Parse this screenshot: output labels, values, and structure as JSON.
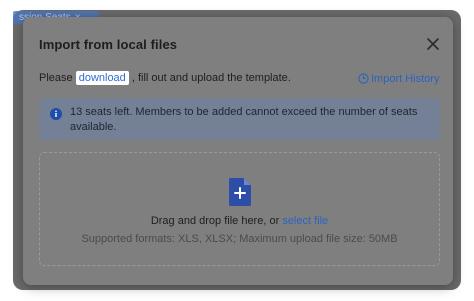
{
  "background": {
    "chip_label": "ssion Seats",
    "chip_close": "×"
  },
  "dialog": {
    "title": "Import from local files",
    "close_icon": "close-icon",
    "instruction_prefix": "Please ",
    "download_link": "download",
    "instruction_suffix": " , fill out and upload the template.",
    "import_history_label": "Import History",
    "alert_text": "13 seats left. Members to be added cannot exceed the number of seats available.",
    "drop_text": "Drag and drop file here, or",
    "select_file_link": "select file",
    "hint_text": "Supported formats: XLS, XLSX; Maximum upload file size: 50MB"
  },
  "colors": {
    "accent": "#2f6fd6",
    "overlay": "#6b6b6b",
    "alert_bg": "#738096",
    "file_icon": "#2c4ea6"
  }
}
